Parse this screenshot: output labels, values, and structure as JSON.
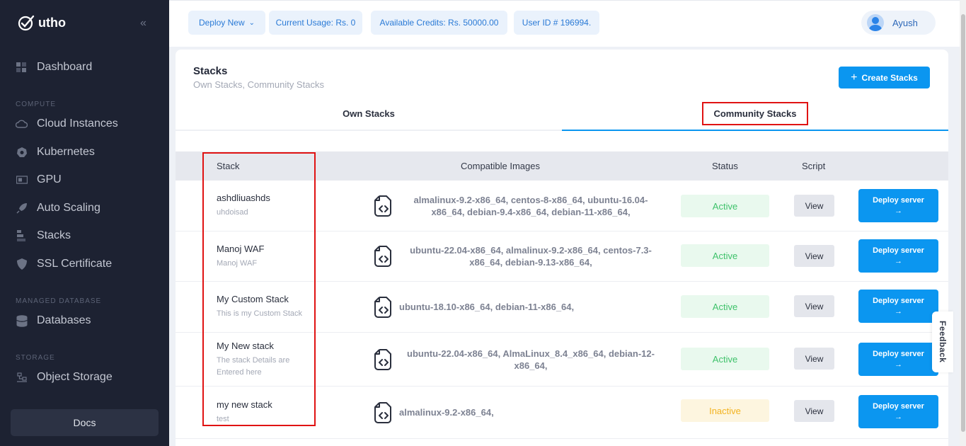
{
  "sidebar": {
    "logo_text": "utho",
    "collapse_icon": "«",
    "sections": [
      "COMPUTE",
      "MANAGED DATABASE",
      "STORAGE"
    ],
    "items": [
      {
        "label": "Dashboard",
        "icon": "dashboard-icon"
      },
      {
        "label": "Cloud Instances",
        "icon": "cloud-icon"
      },
      {
        "label": "Kubernetes",
        "icon": "kubernetes-icon"
      },
      {
        "label": "GPU",
        "icon": "gpu-icon"
      },
      {
        "label": "Auto Scaling",
        "icon": "rocket-icon"
      },
      {
        "label": "Stacks",
        "icon": "stacks-icon"
      },
      {
        "label": "SSL Certificate",
        "icon": "shield-icon"
      },
      {
        "label": "Databases",
        "icon": "database-icon"
      },
      {
        "label": "Object Storage",
        "icon": "storage-icon"
      }
    ],
    "docs_label": "Docs"
  },
  "topbar": {
    "deploy_new": "Deploy New",
    "current_usage": "Current Usage: Rs. 0",
    "available_credits": "Available Credits: Rs. 50000.00",
    "user_id": "User ID # 196994.",
    "user_name": "Ayush"
  },
  "page": {
    "title": "Stacks",
    "subtitle": "Own Stacks, Community Stacks",
    "create_label": "Create Stacks",
    "tabs": [
      "Own Stacks",
      "Community Stacks"
    ],
    "columns": [
      "Stack",
      "Compatible Images",
      "Status",
      "Script"
    ]
  },
  "rows": [
    {
      "name": "ashdliuashds",
      "desc": "uhdoisad",
      "images": "almalinux-9.2-x86_64, centos-8-x86_64, ubuntu-16.04-x86_64, debian-9.4-x86_64, debian-11-x86_64,",
      "status": "Active",
      "view": "View",
      "deploy": "Deploy server",
      "arrow": "→"
    },
    {
      "name": "Manoj WAF",
      "desc": "Manoj WAF",
      "images": "ubuntu-22.04-x86_64, almalinux-9.2-x86_64, centos-7.3-x86_64, debian-9.13-x86_64,",
      "status": "Active",
      "view": "View",
      "deploy": "Deploy server",
      "arrow": "→"
    },
    {
      "name": "My Custom Stack",
      "desc": "This is my Custom Stack",
      "images": "ubuntu-18.10-x86_64, debian-11-x86_64,",
      "status": "Active",
      "view": "View",
      "deploy": "Deploy server",
      "arrow": "→"
    },
    {
      "name": "My New stack",
      "desc": "The stack Details are Entered here",
      "images": "ubuntu-22.04-x86_64, AlmaLinux_8.4_x86_64, debian-12-x86_64,",
      "status": "Active",
      "view": "View",
      "deploy": "Deploy server",
      "arrow": "→"
    },
    {
      "name": "my new stack",
      "desc": "test",
      "images": "almalinux-9.2-x86_64,",
      "status": "Inactive",
      "view": "View",
      "deploy": "Deploy server",
      "arrow": "→"
    }
  ],
  "feedback_label": "Feedback",
  "colors": {
    "accent": "#0b96f0",
    "sidebar_bg": "#1d2232",
    "active": "#3fc26b",
    "inactive": "#f3b321",
    "highlight": "#e01313"
  }
}
